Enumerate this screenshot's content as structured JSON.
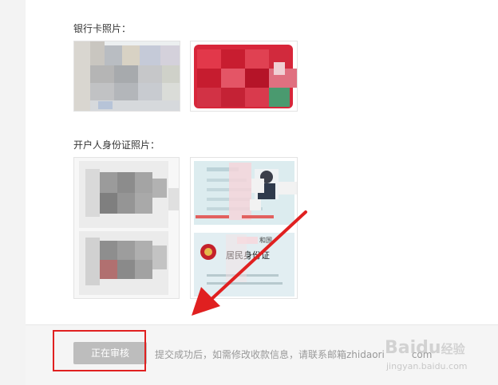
{
  "sections": {
    "bank_card_label": "银行卡照片：",
    "id_card_label": "开户人身份证照片："
  },
  "id_card": {
    "nation_text": "和国",
    "title_text": "居民身份证"
  },
  "footer": {
    "status_button_label": "正在审核",
    "notice_text": "提交成功后，如需修改收款信息，请联系邮箱zhidaori",
    "notice_suffix": "com"
  },
  "watermark": {
    "brand": "Baidu",
    "brand_suffix": "经验",
    "sub": "jingyan.baidu.com"
  },
  "colors": {
    "highlight": "#e02020",
    "arrow": "#e02020",
    "button_bg": "#bdbdbd"
  }
}
